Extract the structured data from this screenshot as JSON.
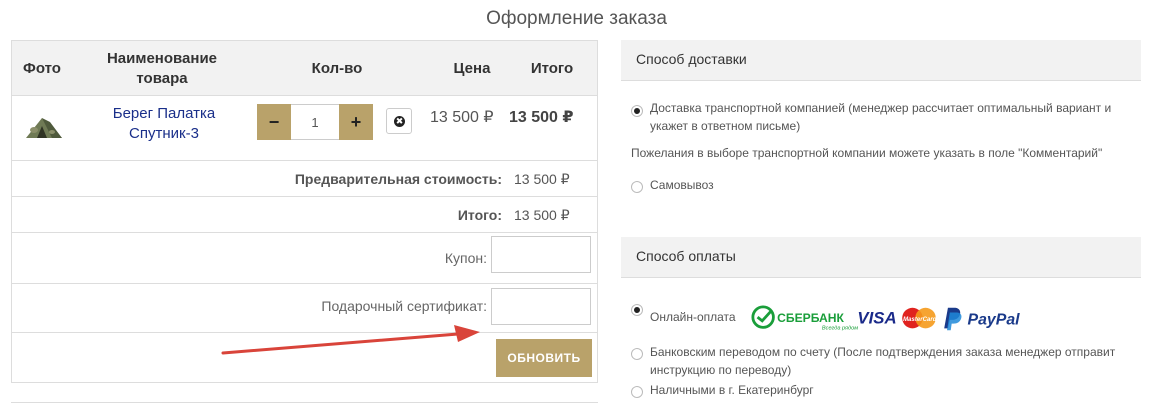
{
  "page": {
    "title": "Оформление заказа"
  },
  "cart": {
    "headers": {
      "photo": "Фото",
      "name": "Наименование товара",
      "qty": "Кол-во",
      "price": "Цена",
      "total": "Итого"
    },
    "item": {
      "name": "Берег Палатка Спутник-3",
      "qty": "1",
      "price": "13 500 ₽",
      "total": "13 500 ₽"
    },
    "qty_minus": "−",
    "qty_plus": "+",
    "remove_symbol": "✖",
    "subtotal_label": "Предварительная стоимость:",
    "subtotal_value": "13 500 ₽",
    "total_label": "Итого:",
    "total_value": "13 500 ₽",
    "coupon_label": "Купон:",
    "certificate_label": "Подарочный сертификат:",
    "update_label": "ОБНОВИТЬ"
  },
  "delivery": {
    "title": "Способ доставки",
    "options": [
      {
        "label": "Доставка транспортной компанией (менеджер рассчитает оптимальный вариант и укажет в ответном письме)",
        "checked": true
      },
      {
        "label": "Самовывоз",
        "checked": false
      }
    ],
    "note": "Пожелания в выборе транспортной компании можете указать в поле \"Комментарий\""
  },
  "payment": {
    "title": "Способ оплаты",
    "options": [
      {
        "label": "Онлайн-оплата",
        "checked": true
      },
      {
        "label": "Банковским переводом по счету (После подтверждения заказа менеджер отправит инструкцию по переводу)",
        "checked": false
      },
      {
        "label": "Наличными в г. Екатеринбург",
        "checked": false
      }
    ],
    "logos": {
      "sberbank": "СБЕРБАНК",
      "sberbank_tagline": "Всегда рядом",
      "visa": "VISA",
      "mastercard": "MasterCard",
      "paypal": "PayPal"
    }
  },
  "colors": {
    "accent": "#b9a26a",
    "link": "#1a2f8a",
    "arrow": "#d9443a",
    "header_bg": "#f2f2f2"
  }
}
